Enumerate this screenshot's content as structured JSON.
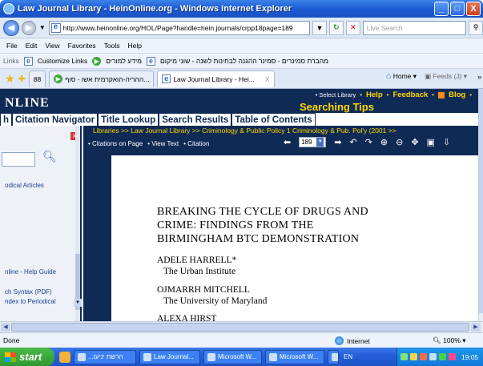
{
  "window": {
    "title": "Law Journal Library - HeinOnline.org - Windows Internet Explorer",
    "minimize": "_",
    "maximize": "□",
    "close": "X"
  },
  "address": {
    "url": "http://www.heinonline.org/HOL/Page?handle=hein.journals/crpp18page=189",
    "search_placeholder": "Live Search"
  },
  "menu": [
    "File",
    "Edit",
    "View",
    "Favorites",
    "Tools",
    "Help"
  ],
  "links_bar": {
    "label": "Links",
    "items": [
      "Customize Links",
      "מידע למורים",
      "מהברת סמינרים - סמינר ההגנה לבחינות לשנה - שוני מיקום"
    ]
  },
  "tabs": {
    "quicktabs": "88",
    "items": [
      {
        "label": "ההריה-הואקרמית אשו - סוף..."
      },
      {
        "label": "Law Journal Library - Hei...",
        "close": "X"
      }
    ],
    "home": "Home",
    "feeds": "Feeds (J)"
  },
  "hol": {
    "logo": "NLINE",
    "select_library": "• Select Library",
    "links": [
      "Help",
      "Feedback",
      "Blog"
    ],
    "searching_tips": "Searching Tips",
    "nav_tabs": [
      "h",
      "Citation Navigator",
      "Title Lookup",
      "Search Results",
      "Table of Contents"
    ],
    "left_panel": {
      "links": [
        "odical Articles",
        "nline - Help Guide",
        "ch Syntax (PDF)",
        "ndex to Periodical"
      ]
    },
    "breadcrumb": "Libraries >> Law Journal Library >> Criminology & Public Policy 1 Criminology & Pub. Pol'y (2001 >>",
    "viewer_links": [
      "• Citations on Page",
      "• View Text",
      "• Citation"
    ],
    "page_number": "189"
  },
  "document": {
    "title_lines": [
      "BREAKING THE CYCLE OF DRUGS AND",
      "CRIME: FINDINGS FROM THE",
      "BIRMINGHAM BTC DEMONSTRATION"
    ],
    "authors": [
      {
        "name": "ADELE HARRELL*",
        "affiliation": "The Urban Institute"
      },
      {
        "name": "OJMARRH MITCHELL",
        "affiliation": "The University of Maryland"
      },
      {
        "name": "ALEXA HIRST",
        "affiliation": ""
      }
    ]
  },
  "status": {
    "text": "Done",
    "zone": "Internet",
    "zoom": "100%"
  },
  "taskbar": {
    "start": "start",
    "tasks": [
      "...הרשת יניעו",
      "Law Journal...",
      "Microsoft W...",
      "Microsoft W..."
    ],
    "lang": "EN",
    "clock": "19:05"
  }
}
